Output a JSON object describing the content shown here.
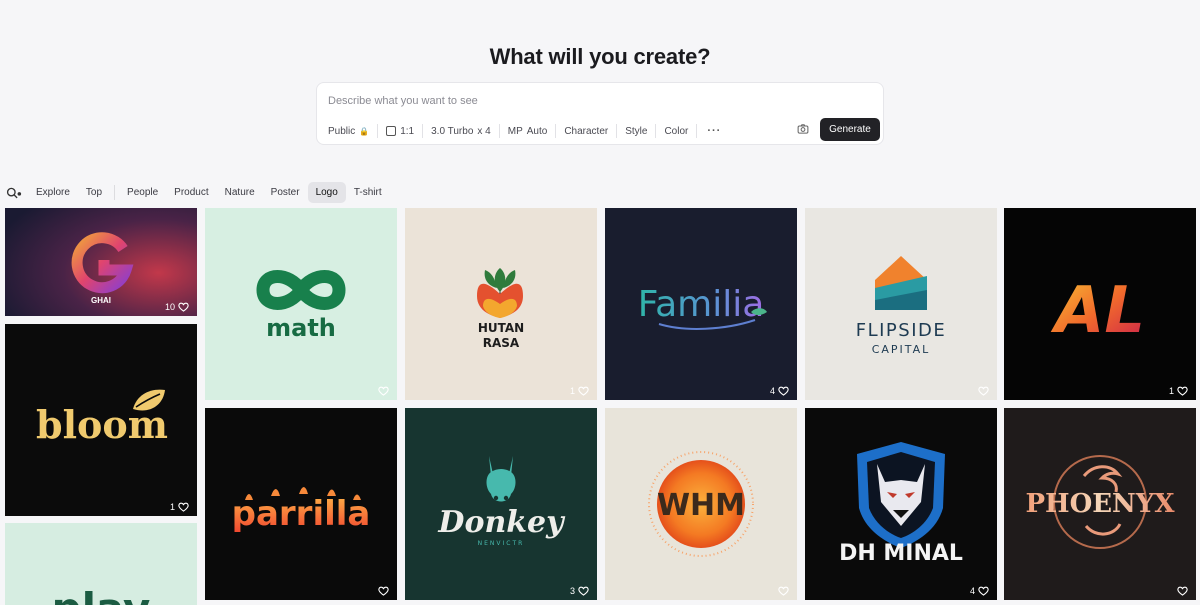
{
  "hero": {
    "title": "What will you create?"
  },
  "prompt": {
    "placeholder": "Describe what you want to see",
    "options": {
      "visibility": "Public",
      "aspect": "1:1",
      "model": "3.0 Turbo",
      "count": "x 4",
      "mp_label": "MP",
      "mp_value": "Auto",
      "character": "Character",
      "style": "Style",
      "color": "Color"
    },
    "generate_label": "Generate"
  },
  "filters": {
    "tabs": [
      "Explore",
      "Top",
      "People",
      "Product",
      "Nature",
      "Poster",
      "Logo",
      "T-shirt"
    ],
    "active": "Logo"
  },
  "gallery": [
    {
      "title": "GHAI",
      "likes": "10",
      "bg": "#231d33"
    },
    {
      "title": "bloom",
      "likes": "1",
      "bg": "#0b0b0b"
    },
    {
      "title": "play",
      "likes": "",
      "bg": "#d6ede1"
    },
    {
      "title": "math",
      "likes": "",
      "bg": "#d7efe2"
    },
    {
      "title": "parrilla",
      "likes": "",
      "bg": "#0a0a0a"
    },
    {
      "title": "HUTAN",
      "subtitle": "RASA",
      "likes": "1",
      "bg": "#ebe3d8"
    },
    {
      "title": "Donkey",
      "subtitle": "NENVICTR",
      "likes": "3",
      "bg": "#173530"
    },
    {
      "title": "Familia",
      "likes": "4",
      "bg": "#191d2e"
    },
    {
      "title": "WHM",
      "likes": "",
      "bg": "#e8e4da"
    },
    {
      "title": "FLIPSIDE",
      "subtitle": "CAPITAL",
      "likes": "",
      "bg": "#e9e7e2"
    },
    {
      "title": "DH MINAL",
      "likes": "4",
      "bg": "#0a0a0a"
    },
    {
      "title": "AL",
      "likes": "1",
      "bg": "#050505"
    },
    {
      "title": "PHOENYX",
      "likes": "",
      "bg": "#1f1b1b"
    }
  ]
}
